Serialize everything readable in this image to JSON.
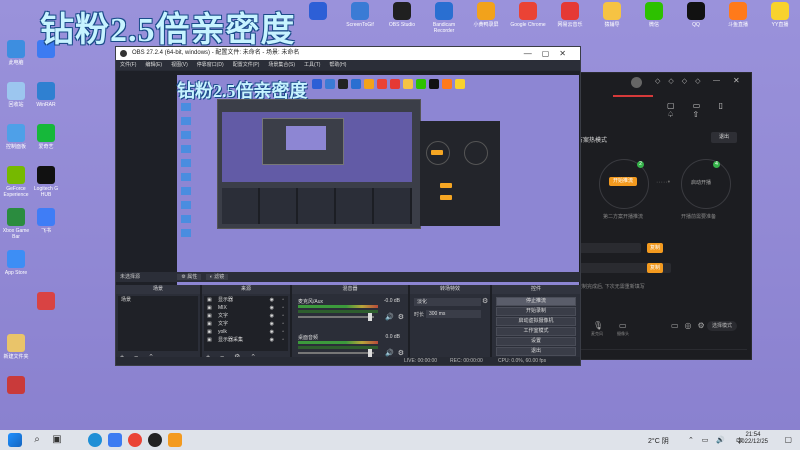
{
  "overlay": {
    "title": "钻粉2.5倍亲密度"
  },
  "desktop_top_icons": [
    {
      "label": "",
      "icon": "monitor-app-icon",
      "color": "#2d5fd6"
    },
    {
      "label": "ScreenToGif",
      "icon": "screentogif-icon",
      "color": "#3a7bd5"
    },
    {
      "label": "OBS Studio",
      "icon": "obs-icon",
      "color": "#202020"
    },
    {
      "label": "Bandicam Recorder",
      "icon": "bandicam-icon",
      "color": "#2a6fd1"
    },
    {
      "label": "小黄鸭录屏",
      "icon": "duck-recorder-icon",
      "color": "#f2a21b"
    },
    {
      "label": "Google Chrome",
      "icon": "chrome-icon",
      "color": "#ea4335"
    },
    {
      "label": "网易云音乐",
      "icon": "netease-music-icon",
      "color": "#e53935"
    },
    {
      "label": "猿辅导",
      "icon": "owl-app-icon",
      "color": "#f6c343"
    },
    {
      "label": "微信",
      "icon": "wechat-icon",
      "color": "#2dc100"
    },
    {
      "label": "QQ",
      "icon": "qq-icon",
      "color": "#111"
    },
    {
      "label": "斗鱼直播",
      "icon": "douyu-icon",
      "color": "#ff7a1a"
    },
    {
      "label": "YY直播",
      "icon": "yy-icon",
      "color": "#f8d22d"
    }
  ],
  "desktop_left_icons": [
    {
      "label": "此电脑",
      "icon": "this-pc-icon",
      "color": "#3d8ee0"
    },
    {
      "label": "",
      "icon": "feishu-icon",
      "color": "#3c7bf2"
    },
    {
      "label": "回收站",
      "icon": "recycle-bin-icon",
      "color": "#9cc6ef"
    },
    {
      "label": "WinRAR",
      "icon": "winrar-icon",
      "color": "#2f80d1"
    },
    {
      "label": "控制面板",
      "icon": "control-panel-icon",
      "color": "#4ea0e8"
    },
    {
      "label": "爱奇艺",
      "icon": "iqiyi-icon",
      "color": "#16b83a"
    },
    {
      "label": "GeForce Experience",
      "icon": "nvidia-icon",
      "color": "#76b900"
    },
    {
      "label": "Logitech G HUB",
      "icon": "logitech-icon",
      "color": "#111"
    },
    {
      "label": "Xbox Game Bar",
      "icon": "xbox-icon",
      "color": "#2b8c3f"
    },
    {
      "label": "飞书",
      "icon": "feishu2-icon",
      "color": "#3f7df6"
    },
    {
      "label": "App Store",
      "icon": "appstore-icon",
      "color": "#3d8ef5"
    },
    {
      "label": "",
      "icon": "red-app-icon",
      "color": "#d94343"
    },
    {
      "label": "新建文件夹",
      "icon": "folder-icon",
      "color": "#e9c46a"
    },
    {
      "label": "",
      "icon": "archive-icon",
      "color": "#c93a3a"
    }
  ],
  "obs": {
    "window_title": "OBS 27.2.4 (64-bit, windows) - 配置文件: 未命名 - 场景: 未命名",
    "menu": [
      "文件(F)",
      "编辑(E)",
      "视图(V)",
      "停靠窗口(D)",
      "配置文件(P)",
      "场景集合(S)",
      "工具(T)",
      "帮助(H)"
    ],
    "context_label": "未选择源",
    "context_buttons": [
      "属性",
      "滤镜"
    ],
    "docks": {
      "scenes": {
        "header": "场景",
        "items": [
          "场景"
        ]
      },
      "sources": {
        "header": "来源",
        "items": [
          "显示器",
          "MIX",
          "文字",
          "文字",
          "yolk",
          "显示器采集"
        ]
      },
      "mixer": {
        "header": "混音器",
        "tracks": [
          {
            "name": "麦克风/Aux",
            "level": "-0.0 dB"
          },
          {
            "name": "桌面音频",
            "level": "0.0 dB"
          }
        ]
      },
      "transitions": {
        "header": "转场特效",
        "type": "淡化",
        "duration_label": "时长",
        "duration": "300 ms"
      },
      "controls": {
        "header": "控件",
        "buttons": [
          "停止推流",
          "开始录制",
          "启动虚拟摄像机",
          "工作室模式",
          "设置",
          "退出"
        ]
      }
    },
    "status": {
      "live": "LIVE: 00:00:00",
      "rec": "REC: 00:00:00",
      "cpu": "CPU: 0.0%, 60.00 fps"
    }
  },
  "app2": {
    "mode_title": "方案热模式",
    "exit_button": "退出",
    "orange_main": "开始推流",
    "right_circle_label": "启动开播",
    "badge_left": "2",
    "badge_right": "4",
    "hint_left": "第二方案开播推流",
    "hint_right": "开播前需要准备",
    "copy_btn1": "复制",
    "copy_btn2": "复制",
    "notice": "复制完成后, 下次无需重新填写",
    "mic_label": "麦克风",
    "cam_label": "摄像头",
    "edit_btn": "选择模式"
  },
  "taskbar": {
    "weather": "2°C 阴",
    "lang": "中",
    "time": "21:54",
    "date": "2022/12/25"
  }
}
